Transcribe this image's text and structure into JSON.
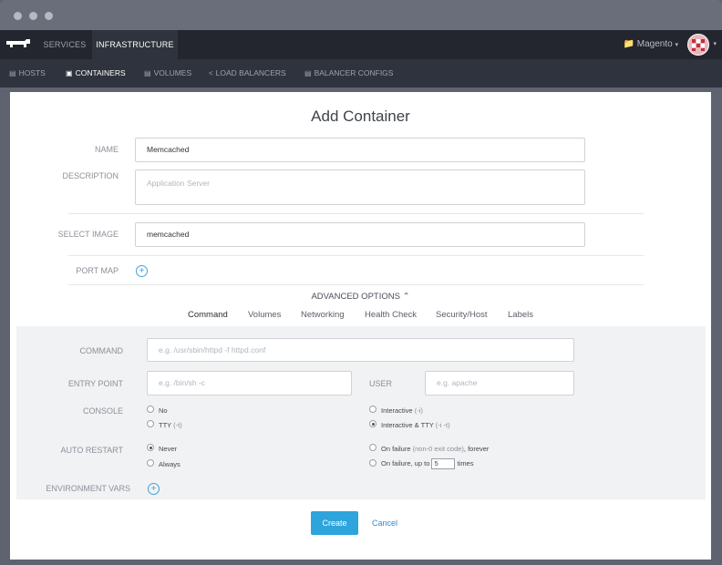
{
  "window": {
    "title_dots": [
      "close",
      "minimize",
      "maximize"
    ]
  },
  "topnav": {
    "tabs": [
      {
        "label": "SERVICES"
      },
      {
        "label": "INFRASTRUCTURE"
      }
    ],
    "environment": "Magento"
  },
  "subnav": {
    "items": [
      {
        "label": "HOSTS",
        "icon": "server-icon"
      },
      {
        "label": "CONTAINERS",
        "icon": "container-icon"
      },
      {
        "label": "VOLUMES",
        "icon": "volume-icon"
      },
      {
        "label": "LOAD BALANCERS",
        "icon": "share-icon"
      },
      {
        "label": "BALANCER CONFIGS",
        "icon": "config-icon"
      }
    ]
  },
  "form": {
    "title": "Add Container",
    "name_label": "NAME",
    "name_value": "Memcached",
    "description_label": "DESCRIPTION",
    "description_placeholder": "Application Server",
    "image_label": "SELECT IMAGE",
    "image_value": "memcached",
    "portmap_label": "PORT MAP"
  },
  "advanced": {
    "toggle_label": "ADVANCED OPTIONS",
    "tabs": [
      {
        "label": "Command"
      },
      {
        "label": "Volumes"
      },
      {
        "label": "Networking"
      },
      {
        "label": "Health Check"
      },
      {
        "label": "Security/Host"
      },
      {
        "label": "Labels"
      }
    ],
    "command_label": "COMMAND",
    "command_placeholder": "e.g. /usr/sbin/httpd -f httpd.conf",
    "entry_label": "ENTRY POINT",
    "entry_placeholder": "e.g. /bin/sh -c",
    "user_label": "USER",
    "user_placeholder": "e.g. apache",
    "console_label": "CONSOLE",
    "console_options": {
      "no": "No",
      "tty": "TTY",
      "tty_hint": "(-t)",
      "interactive": "Interactive",
      "interactive_hint": "(-i)",
      "interactive_tty": "Interactive & TTY",
      "interactive_tty_hint": "(-i -t)"
    },
    "restart_label": "AUTO RESTART",
    "restart_options": {
      "never": "Never",
      "always": "Always",
      "on_failure_forever": "On failure",
      "on_failure_forever_hint": "(non-0 exit code)",
      "on_failure_forever_suffix": ", forever",
      "on_failure_up_to": "On failure, up to",
      "retries": "5",
      "times": "times"
    },
    "env_label": "ENVIRONMENT VARS"
  },
  "actions": {
    "create": "Create",
    "cancel": "Cancel"
  },
  "colors": {
    "accent": "#2ea4dc",
    "nav_bg": "#23262f",
    "subnav_bg": "#2f333d"
  }
}
